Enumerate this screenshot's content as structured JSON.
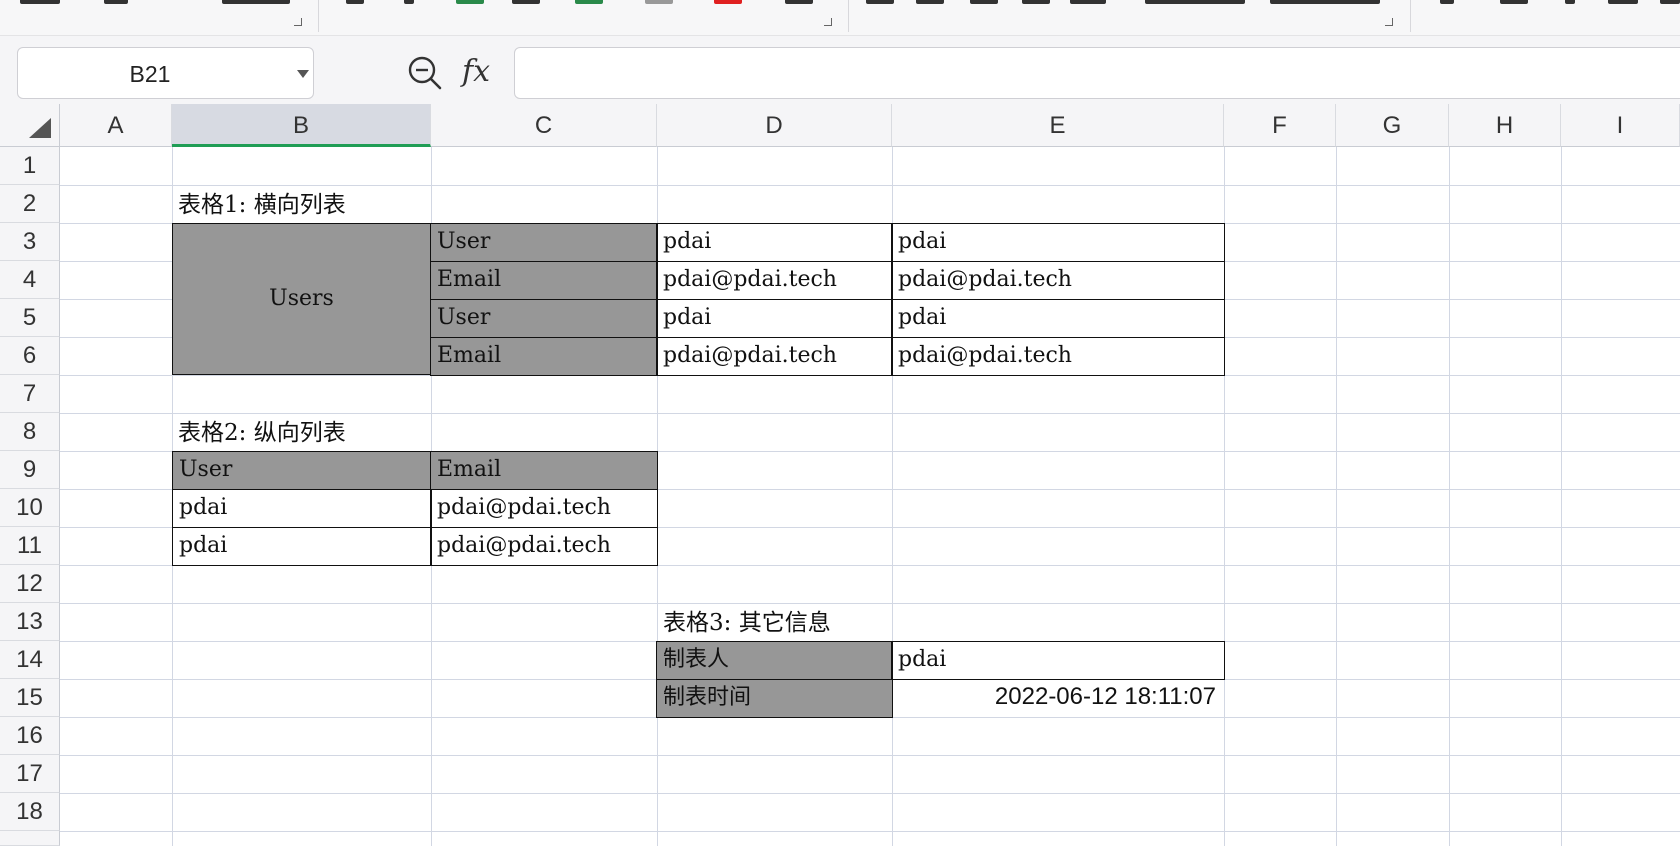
{
  "name_box": {
    "value": "B21"
  },
  "formula_bar": {
    "fx_label": "fx",
    "content": ""
  },
  "columns": [
    "A",
    "B",
    "C",
    "D",
    "E",
    "F",
    "G",
    "H",
    "I"
  ],
  "selected_column": "B",
  "rows": [
    "1",
    "2",
    "3",
    "4",
    "5",
    "6",
    "7",
    "8",
    "9",
    "10",
    "11",
    "12",
    "13",
    "14",
    "15",
    "16",
    "17",
    "18"
  ],
  "sheet": {
    "table1": {
      "title": "表格1: 横向列表",
      "group_label": "Users",
      "rows": [
        {
          "label": "User",
          "values": [
            "pdai",
            "pdai"
          ]
        },
        {
          "label": "Email",
          "values": [
            "pdai@pdai.tech",
            "pdai@pdai.tech"
          ]
        },
        {
          "label": "User",
          "values": [
            "pdai",
            "pdai"
          ]
        },
        {
          "label": "Email",
          "values": [
            "pdai@pdai.tech",
            "pdai@pdai.tech"
          ]
        }
      ]
    },
    "table2": {
      "title": "表格2:  纵向列表",
      "headers": [
        "User",
        "Email"
      ],
      "rows": [
        [
          "pdai",
          "pdai@pdai.tech"
        ],
        [
          "pdai",
          "pdai@pdai.tech"
        ]
      ]
    },
    "table3": {
      "title": "表格3: 其它信息",
      "rows": [
        {
          "label": "制表人",
          "value": "pdai"
        },
        {
          "label": "制表时间",
          "value": "2022-06-12 18:11:07"
        }
      ]
    }
  },
  "colors": {
    "header_fill": "#979797",
    "selected_col_underline": "#1f9d55",
    "grid": "#d2d7e3"
  }
}
